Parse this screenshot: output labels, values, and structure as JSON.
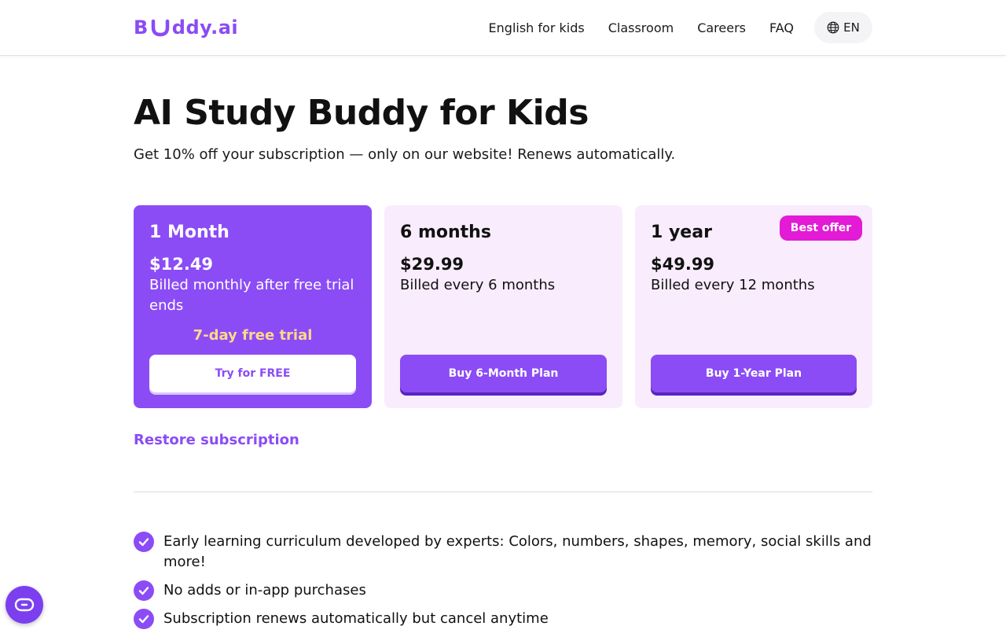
{
  "header": {
    "logo": {
      "left": "B",
      "right": "ddy.ai"
    },
    "nav": [
      "English for kids",
      "Classroom",
      "Careers",
      "FAQ"
    ],
    "language": "EN"
  },
  "hero": {
    "title": "AI Study Buddy for Kids",
    "subtitle": "Get 10% off your subscription — only on our website! Renews automatically."
  },
  "plans": [
    {
      "name": "1 Month",
      "price": "$12.49",
      "billing": "Billed monthly after free trial ends",
      "trial": "7-day free trial",
      "button": "Try for FREE"
    },
    {
      "name": "6 months",
      "price": "$29.99",
      "billing": "Billed every 6 months",
      "button": "Buy 6-Month Plan"
    },
    {
      "name": "1 year",
      "price": "$49.99",
      "billing": "Billed every 12 months",
      "button": "Buy 1-Year Plan",
      "badge": "Best offer"
    }
  ],
  "restore_link": "Restore subscription",
  "features": [
    "Early learning curriculum developed by experts: Colors, numbers, shapes, memory, social skills and more!",
    "No adds or in-app purchases",
    "Subscription renews automatically but cancel anytime"
  ],
  "colors": {
    "accent": "#8b4cf6",
    "badge": "#e31ad6",
    "card_bg": "#f9ecfc",
    "trial_text": "#ffd88a"
  },
  "icons": {
    "language": "globe-icon",
    "check": "check-circle-icon",
    "fab": "chat-bubble-icon"
  }
}
